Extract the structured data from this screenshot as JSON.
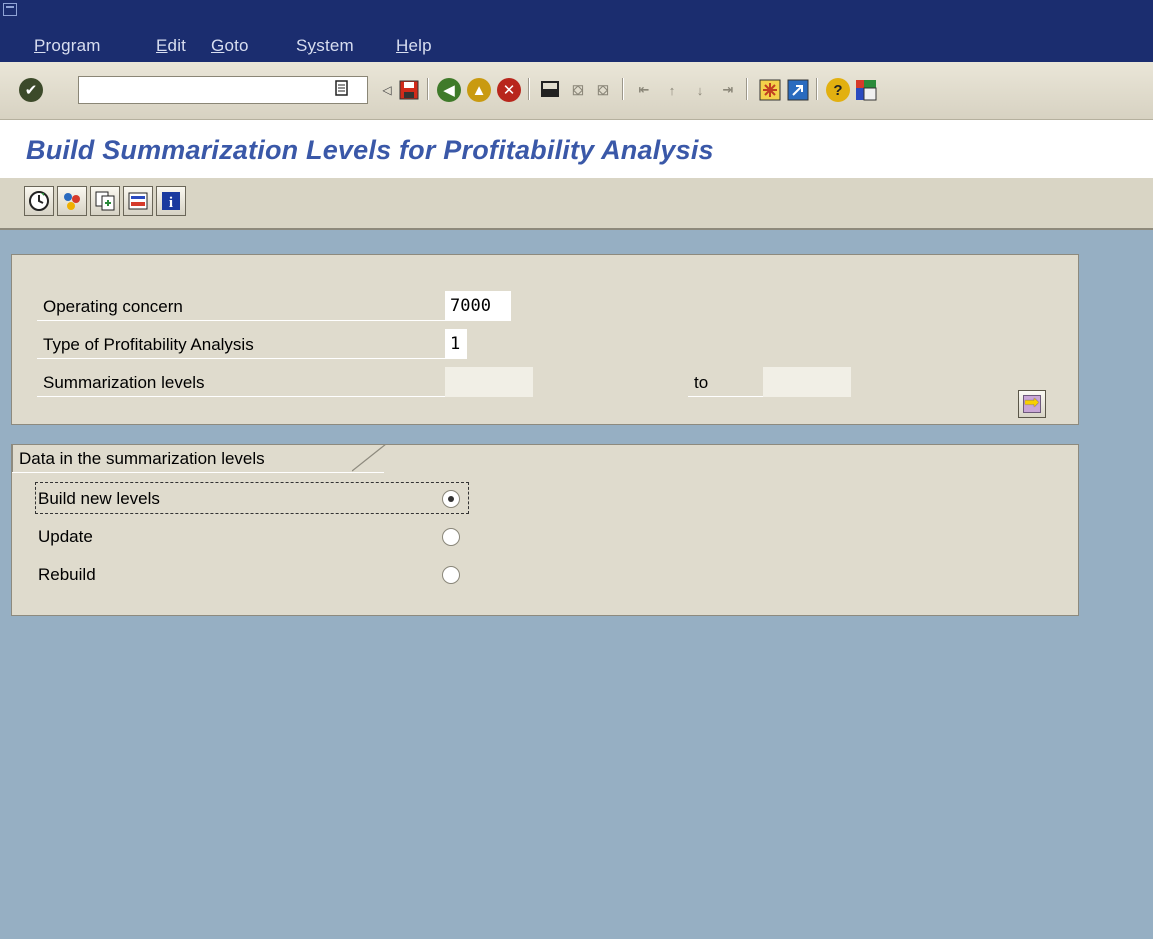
{
  "menu": {
    "items": [
      {
        "label": "Program"
      },
      {
        "label": "Edit"
      },
      {
        "label": "Goto"
      },
      {
        "label": "System"
      },
      {
        "label": "Help"
      }
    ]
  },
  "toolbar": {
    "command_field_value": "",
    "icons": [
      "enter-icon",
      "command-field-menu-icon",
      "collapse-icon",
      "save-icon",
      "back-icon",
      "exit-icon",
      "cancel-icon",
      "print-icon",
      "find-icon",
      "find-next-icon",
      "first-page-icon",
      "previous-page-icon",
      "next-page-icon",
      "last-page-icon",
      "create-session-icon",
      "create-shortcut-icon",
      "help-icon",
      "layout-menu-icon"
    ]
  },
  "page_title": "Build Summarization Levels for Profitability Analysis",
  "app_toolbar": {
    "icons": [
      "execute-icon",
      "get-variant-icon",
      "copy-icon",
      "selection-options-icon",
      "information-icon"
    ]
  },
  "selection": {
    "operating_concern": {
      "label": "Operating concern",
      "value": "7000"
    },
    "type_of_pa": {
      "label": "Type of Profitability Analysis",
      "value": "1"
    },
    "summarization_levels": {
      "label": "Summarization levels",
      "from_value": "",
      "to_label": "to",
      "to_value": ""
    }
  },
  "data_frame": {
    "title": "Data in the summarization levels",
    "options": [
      {
        "label": "Build new levels",
        "selected": true
      },
      {
        "label": "Update",
        "selected": false
      },
      {
        "label": "Rebuild",
        "selected": false
      }
    ]
  },
  "colors": {
    "menubar": "#1b2d6f",
    "title": "#3a58a8",
    "workarea": "#96afc3",
    "frame": "#dfdbcd"
  }
}
